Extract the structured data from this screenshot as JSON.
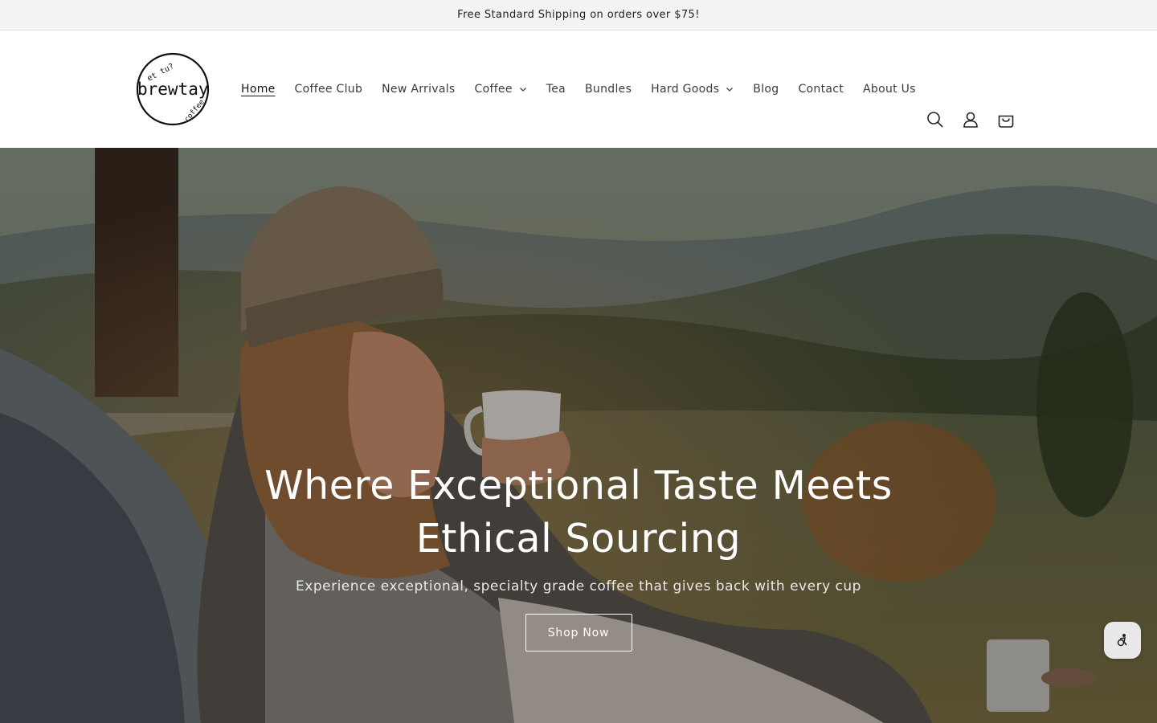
{
  "announcement": {
    "text": "Free Standard Shipping on orders over $75!"
  },
  "logo": {
    "brand": "brewtay",
    "top_text": "et tu?",
    "bottom_text": "coffee",
    "icon": "logo-circle"
  },
  "nav": {
    "items": [
      {
        "label": "Home",
        "active": true,
        "has_dropdown": false
      },
      {
        "label": "Coffee Club",
        "active": false,
        "has_dropdown": false
      },
      {
        "label": "New Arrivals",
        "active": false,
        "has_dropdown": false
      },
      {
        "label": "Coffee",
        "active": false,
        "has_dropdown": true
      },
      {
        "label": "Tea",
        "active": false,
        "has_dropdown": false
      },
      {
        "label": "Bundles",
        "active": false,
        "has_dropdown": false
      },
      {
        "label": "Hard Goods",
        "active": false,
        "has_dropdown": true
      },
      {
        "label": "Blog",
        "active": false,
        "has_dropdown": false
      },
      {
        "label": "Contact",
        "active": false,
        "has_dropdown": false
      },
      {
        "label": "About Us",
        "active": false,
        "has_dropdown": false
      }
    ]
  },
  "header_icons": [
    "search-icon",
    "account-icon",
    "cart-icon"
  ],
  "hero": {
    "title": "Where Exceptional Taste Meets Ethical Sourcing",
    "subtitle": "Experience exceptional, specialty grade coffee that gives back with every cup",
    "button_label": "Shop Now"
  },
  "widget": {
    "icon": "accessibility-icon"
  },
  "colors": {
    "announcement_bg": "#f3f3f3",
    "text": "#121212",
    "hero_text": "#ffffff"
  }
}
